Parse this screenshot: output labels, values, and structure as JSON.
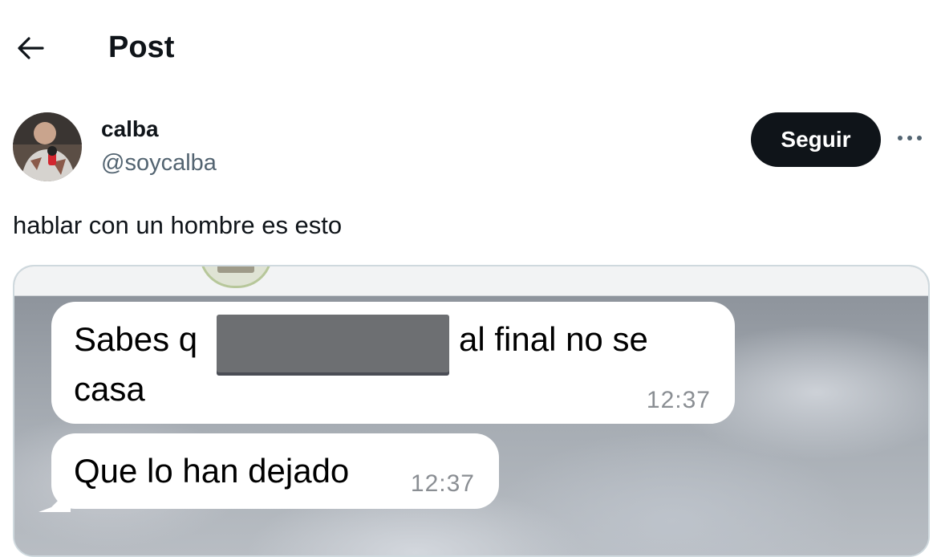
{
  "header": {
    "title": "Post",
    "back_icon": "arrow-left-icon"
  },
  "author": {
    "name": "calba",
    "handle": "@soycalba",
    "follow_label": "Seguir",
    "more_icon": "more-horizontal-icon"
  },
  "post": {
    "text": "hablar con un hombre es esto"
  },
  "screenshot": {
    "message1": {
      "before_redaction": "Sabes q",
      "after_redaction": "al final no se",
      "line2": "casa",
      "time": "12:37"
    },
    "message2": {
      "text": "Que lo han dejado",
      "time": "12:37"
    }
  },
  "colors": {
    "text": "#0f1419",
    "secondary": "#536471",
    "follow_bg": "#0f1419",
    "bubble": "#ffffff"
  }
}
